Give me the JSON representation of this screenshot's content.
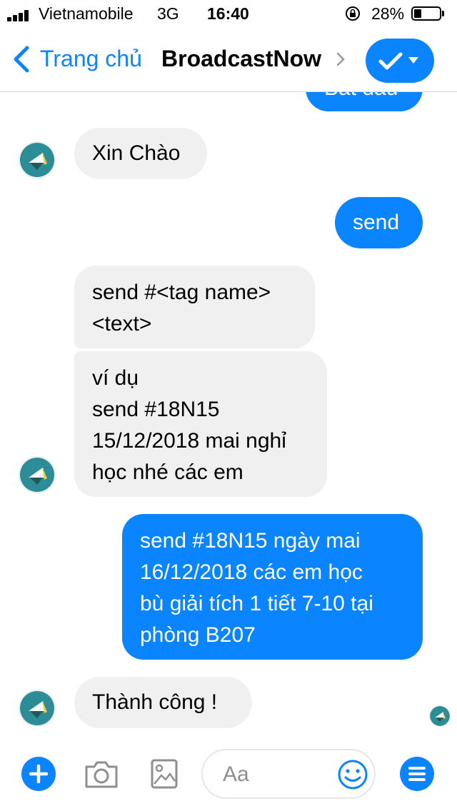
{
  "status_bar": {
    "carrier": "Vietnamobile",
    "network": "3G",
    "time": "16:40",
    "battery": "28%"
  },
  "header": {
    "back_label": "Trang chủ",
    "title": "BroadcastNow",
    "action_icon": "checkmark-icon"
  },
  "messages": [
    {
      "from": "me",
      "text": "Bắt đầu"
    },
    {
      "from": "bot",
      "text": "Xin Chào"
    },
    {
      "from": "me",
      "text": "send"
    },
    {
      "from": "bot",
      "text": "send #<tag name>\n<text>"
    },
    {
      "from": "bot",
      "text": "ví dụ\nsend #18N15\n15/12/2018 mai nghỉ\nhọc nhé các em"
    },
    {
      "from": "me",
      "text": "send #18N15 ngày mai\n16/12/2018 các em học\nbù giải tích 1 tiết 7-10 tại\nphòng B207"
    },
    {
      "from": "bot",
      "text": "Thành công !"
    }
  ],
  "composer": {
    "placeholder": "Aa"
  },
  "colors": {
    "accent": "#0a84ff",
    "incoming_bubble": "#f0f0f0",
    "avatar_teal": "#2d8d96",
    "avatar_yellow": "#f2cf3c"
  }
}
